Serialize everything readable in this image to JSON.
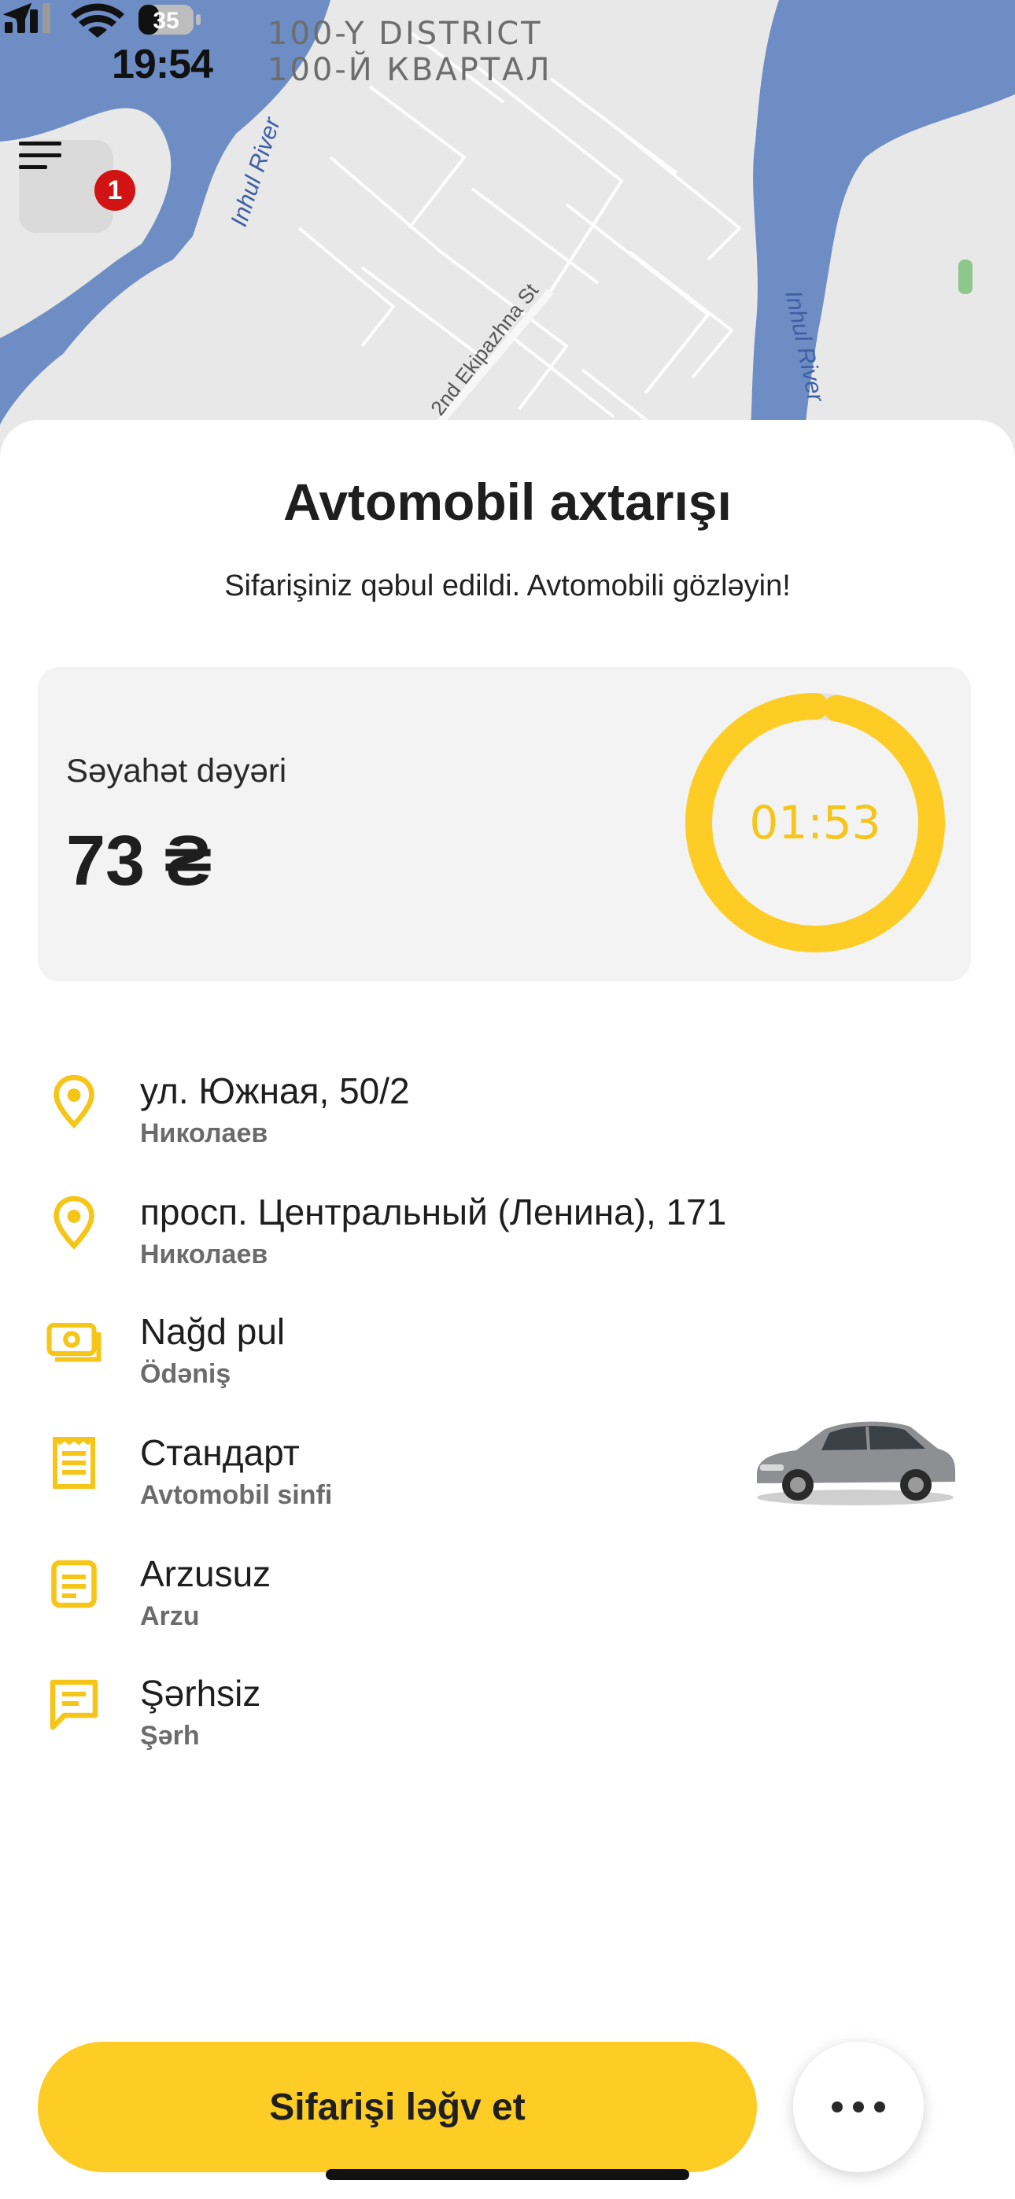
{
  "status_bar": {
    "time": "19:54",
    "district_line1": "100-Y DISTRICT",
    "district_line2": "100-Й КВАРТАЛ",
    "battery": "35",
    "icons": [
      "location-arrow-icon",
      "signal-icon",
      "wifi-icon",
      "battery-icon"
    ]
  },
  "map": {
    "labels": [
      "Inhul River",
      "2nd Ekipazhna St",
      "Inhul River"
    ]
  },
  "menu": {
    "badge_count": "1",
    "icon": "hamburger-menu-icon"
  },
  "sheet": {
    "title": "Avtomobil axtarışı",
    "subtitle": "Sifarişiniz qəbul edildi. Avtomobili gözləyin!"
  },
  "fare": {
    "label": "Səyahət dəyəri",
    "value": "73 ₴",
    "timer": "01:53",
    "timer_progress": 0.97
  },
  "details": [
    {
      "icon": "location-pin-icon",
      "main": "ул. Южная, 50/2",
      "sub": "Николаев"
    },
    {
      "icon": "location-pin-icon",
      "main": "просп. Центральный (Ленина), 171",
      "sub": "Николаев"
    },
    {
      "icon": "cash-icon",
      "main": "Nağd pul",
      "sub": "Ödəniş"
    },
    {
      "icon": "receipt-icon",
      "main": "Стандарт",
      "sub": "Avtomobil sinfi"
    },
    {
      "icon": "document-list-icon",
      "main": "Arzusuz",
      "sub": "Arzu"
    },
    {
      "icon": "comment-icon",
      "main": "Şərhsiz",
      "sub": "Şərh"
    }
  ],
  "actions": {
    "cancel_label": "Sifarişi ləğv et",
    "more_icon": "more-dots-icon"
  },
  "colors": {
    "accent": "#fdcd25",
    "badge": "#d11313",
    "water": "#6d8dc4"
  }
}
